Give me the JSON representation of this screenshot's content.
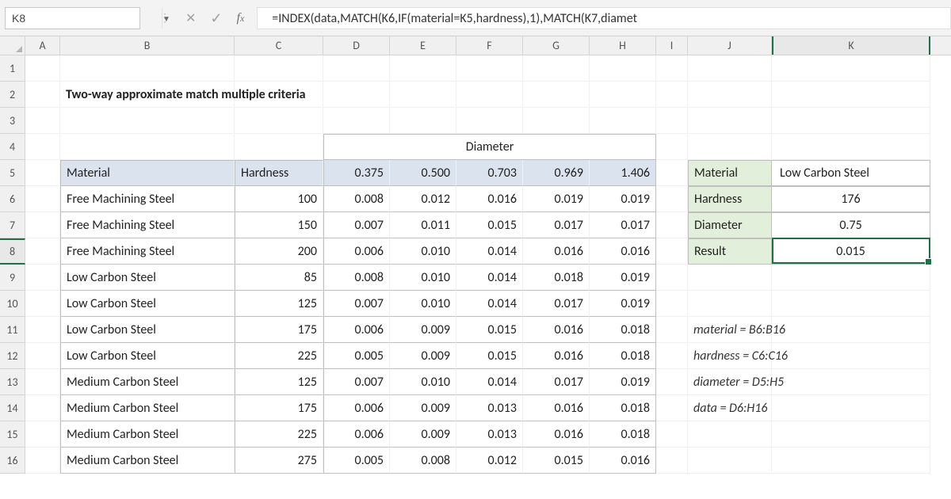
{
  "name_box": "K8",
  "formula": "=INDEX(data,MATCH(K6,IF(material=K5,hardness),1),MATCH(K7,diamet",
  "title": "Two-way approximate match multiple criteria",
  "columns": [
    "A",
    "B",
    "C",
    "D",
    "E",
    "F",
    "G",
    "H",
    "I",
    "J",
    "K"
  ],
  "row_numbers": [
    "1",
    "2",
    "3",
    "4",
    "5",
    "6",
    "7",
    "8",
    "9",
    "10",
    "11",
    "12",
    "13",
    "14",
    "15",
    "16"
  ],
  "table": {
    "diameter_label": "Diameter",
    "material_header": "Material",
    "hardness_header": "Hardness",
    "diameter_cols": [
      "0.375",
      "0.500",
      "0.703",
      "0.969",
      "1.406"
    ],
    "rows": [
      {
        "material": "Free Machining Steel",
        "hardness": "100",
        "vals": [
          "0.008",
          "0.012",
          "0.016",
          "0.019",
          "0.019"
        ]
      },
      {
        "material": "Free Machining Steel",
        "hardness": "150",
        "vals": [
          "0.007",
          "0.011",
          "0.015",
          "0.017",
          "0.017"
        ]
      },
      {
        "material": "Free Machining Steel",
        "hardness": "200",
        "vals": [
          "0.006",
          "0.010",
          "0.014",
          "0.016",
          "0.016"
        ]
      },
      {
        "material": "Low Carbon Steel",
        "hardness": "85",
        "vals": [
          "0.008",
          "0.010",
          "0.014",
          "0.018",
          "0.019"
        ]
      },
      {
        "material": "Low Carbon Steel",
        "hardness": "125",
        "vals": [
          "0.007",
          "0.010",
          "0.014",
          "0.017",
          "0.019"
        ]
      },
      {
        "material": "Low Carbon Steel",
        "hardness": "175",
        "vals": [
          "0.006",
          "0.009",
          "0.015",
          "0.016",
          "0.018"
        ]
      },
      {
        "material": "Low Carbon Steel",
        "hardness": "225",
        "vals": [
          "0.005",
          "0.009",
          "0.015",
          "0.016",
          "0.018"
        ]
      },
      {
        "material": "Medium Carbon Steel",
        "hardness": "125",
        "vals": [
          "0.007",
          "0.010",
          "0.014",
          "0.017",
          "0.019"
        ]
      },
      {
        "material": "Medium Carbon Steel",
        "hardness": "175",
        "vals": [
          "0.006",
          "0.009",
          "0.013",
          "0.016",
          "0.018"
        ]
      },
      {
        "material": "Medium Carbon Steel",
        "hardness": "225",
        "vals": [
          "0.006",
          "0.009",
          "0.013",
          "0.016",
          "0.018"
        ]
      },
      {
        "material": "Medium Carbon Steel",
        "hardness": "275",
        "vals": [
          "0.005",
          "0.008",
          "0.012",
          "0.015",
          "0.016"
        ]
      }
    ]
  },
  "lookup": {
    "material_label": "Material",
    "material_val": "Low Carbon Steel",
    "hardness_label": "Hardness",
    "hardness_val": "176",
    "diameter_label": "Diameter",
    "diameter_val": "0.75",
    "result_label": "Result",
    "result_val": "0.015"
  },
  "named_ranges": [
    "material = B6:B16",
    "hardness = C6:C16",
    "diameter = D5:H5",
    "data = D6:H16"
  ],
  "active_cell": "K8"
}
